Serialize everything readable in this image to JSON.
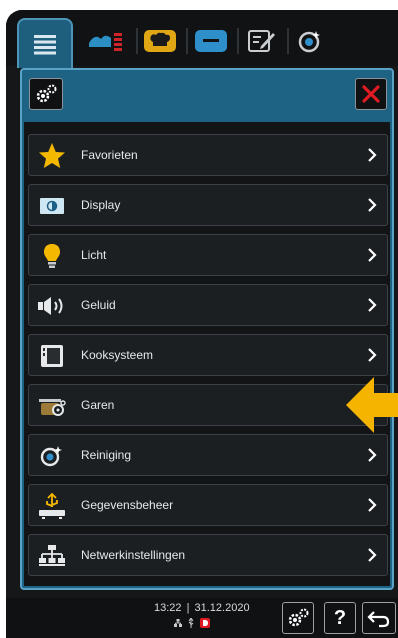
{
  "menu": {
    "items": [
      {
        "label": "Favorieten",
        "icon": "star-icon"
      },
      {
        "label": "Display",
        "icon": "display-icon"
      },
      {
        "label": "Licht",
        "icon": "bulb-icon"
      },
      {
        "label": "Geluid",
        "icon": "speaker-icon"
      },
      {
        "label": "Kooksysteem",
        "icon": "cooking-system-icon"
      },
      {
        "label": "Garen",
        "icon": "pot-gear-icon"
      },
      {
        "label": "Reiniging",
        "icon": "cleaning-icon"
      },
      {
        "label": "Gegevensbeheer",
        "icon": "usb-data-icon"
      },
      {
        "label": "Netwerkinstellingen",
        "icon": "network-icon"
      }
    ]
  },
  "footer": {
    "time": "13:22",
    "separator": "|",
    "date": "31.12.2020",
    "help_label": "?"
  },
  "colors": {
    "accent": "#1e6284",
    "close": "#e11b22",
    "star": "#f5b800",
    "arrow": "#f4b400"
  }
}
